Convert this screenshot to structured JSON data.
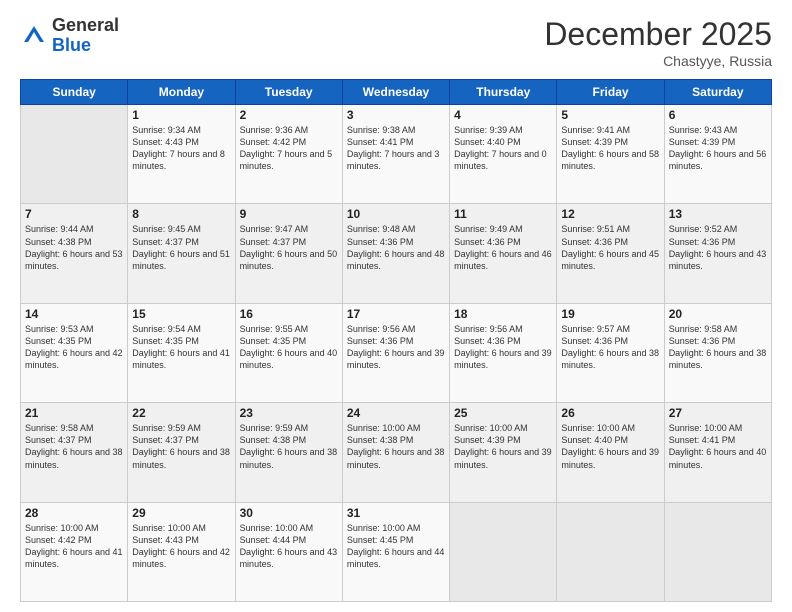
{
  "logo": {
    "general": "General",
    "blue": "Blue"
  },
  "header": {
    "title": "December 2025",
    "location": "Chastyye, Russia"
  },
  "weekdays": [
    "Sunday",
    "Monday",
    "Tuesday",
    "Wednesday",
    "Thursday",
    "Friday",
    "Saturday"
  ],
  "weeks": [
    [
      {
        "day": "",
        "content": ""
      },
      {
        "day": "1",
        "sunrise": "Sunrise: 9:34 AM",
        "sunset": "Sunset: 4:43 PM",
        "daylight": "Daylight: 7 hours and 8 minutes."
      },
      {
        "day": "2",
        "sunrise": "Sunrise: 9:36 AM",
        "sunset": "Sunset: 4:42 PM",
        "daylight": "Daylight: 7 hours and 5 minutes."
      },
      {
        "day": "3",
        "sunrise": "Sunrise: 9:38 AM",
        "sunset": "Sunset: 4:41 PM",
        "daylight": "Daylight: 7 hours and 3 minutes."
      },
      {
        "day": "4",
        "sunrise": "Sunrise: 9:39 AM",
        "sunset": "Sunset: 4:40 PM",
        "daylight": "Daylight: 7 hours and 0 minutes."
      },
      {
        "day": "5",
        "sunrise": "Sunrise: 9:41 AM",
        "sunset": "Sunset: 4:39 PM",
        "daylight": "Daylight: 6 hours and 58 minutes."
      },
      {
        "day": "6",
        "sunrise": "Sunrise: 9:43 AM",
        "sunset": "Sunset: 4:39 PM",
        "daylight": "Daylight: 6 hours and 56 minutes."
      }
    ],
    [
      {
        "day": "7",
        "sunrise": "Sunrise: 9:44 AM",
        "sunset": "Sunset: 4:38 PM",
        "daylight": "Daylight: 6 hours and 53 minutes."
      },
      {
        "day": "8",
        "sunrise": "Sunrise: 9:45 AM",
        "sunset": "Sunset: 4:37 PM",
        "daylight": "Daylight: 6 hours and 51 minutes."
      },
      {
        "day": "9",
        "sunrise": "Sunrise: 9:47 AM",
        "sunset": "Sunset: 4:37 PM",
        "daylight": "Daylight: 6 hours and 50 minutes."
      },
      {
        "day": "10",
        "sunrise": "Sunrise: 9:48 AM",
        "sunset": "Sunset: 4:36 PM",
        "daylight": "Daylight: 6 hours and 48 minutes."
      },
      {
        "day": "11",
        "sunrise": "Sunrise: 9:49 AM",
        "sunset": "Sunset: 4:36 PM",
        "daylight": "Daylight: 6 hours and 46 minutes."
      },
      {
        "day": "12",
        "sunrise": "Sunrise: 9:51 AM",
        "sunset": "Sunset: 4:36 PM",
        "daylight": "Daylight: 6 hours and 45 minutes."
      },
      {
        "day": "13",
        "sunrise": "Sunrise: 9:52 AM",
        "sunset": "Sunset: 4:36 PM",
        "daylight": "Daylight: 6 hours and 43 minutes."
      }
    ],
    [
      {
        "day": "14",
        "sunrise": "Sunrise: 9:53 AM",
        "sunset": "Sunset: 4:35 PM",
        "daylight": "Daylight: 6 hours and 42 minutes."
      },
      {
        "day": "15",
        "sunrise": "Sunrise: 9:54 AM",
        "sunset": "Sunset: 4:35 PM",
        "daylight": "Daylight: 6 hours and 41 minutes."
      },
      {
        "day": "16",
        "sunrise": "Sunrise: 9:55 AM",
        "sunset": "Sunset: 4:35 PM",
        "daylight": "Daylight: 6 hours and 40 minutes."
      },
      {
        "day": "17",
        "sunrise": "Sunrise: 9:56 AM",
        "sunset": "Sunset: 4:36 PM",
        "daylight": "Daylight: 6 hours and 39 minutes."
      },
      {
        "day": "18",
        "sunrise": "Sunrise: 9:56 AM",
        "sunset": "Sunset: 4:36 PM",
        "daylight": "Daylight: 6 hours and 39 minutes."
      },
      {
        "day": "19",
        "sunrise": "Sunrise: 9:57 AM",
        "sunset": "Sunset: 4:36 PM",
        "daylight": "Daylight: 6 hours and 38 minutes."
      },
      {
        "day": "20",
        "sunrise": "Sunrise: 9:58 AM",
        "sunset": "Sunset: 4:36 PM",
        "daylight": "Daylight: 6 hours and 38 minutes."
      }
    ],
    [
      {
        "day": "21",
        "sunrise": "Sunrise: 9:58 AM",
        "sunset": "Sunset: 4:37 PM",
        "daylight": "Daylight: 6 hours and 38 minutes."
      },
      {
        "day": "22",
        "sunrise": "Sunrise: 9:59 AM",
        "sunset": "Sunset: 4:37 PM",
        "daylight": "Daylight: 6 hours and 38 minutes."
      },
      {
        "day": "23",
        "sunrise": "Sunrise: 9:59 AM",
        "sunset": "Sunset: 4:38 PM",
        "daylight": "Daylight: 6 hours and 38 minutes."
      },
      {
        "day": "24",
        "sunrise": "Sunrise: 10:00 AM",
        "sunset": "Sunset: 4:38 PM",
        "daylight": "Daylight: 6 hours and 38 minutes."
      },
      {
        "day": "25",
        "sunrise": "Sunrise: 10:00 AM",
        "sunset": "Sunset: 4:39 PM",
        "daylight": "Daylight: 6 hours and 39 minutes."
      },
      {
        "day": "26",
        "sunrise": "Sunrise: 10:00 AM",
        "sunset": "Sunset: 4:40 PM",
        "daylight": "Daylight: 6 hours and 39 minutes."
      },
      {
        "day": "27",
        "sunrise": "Sunrise: 10:00 AM",
        "sunset": "Sunset: 4:41 PM",
        "daylight": "Daylight: 6 hours and 40 minutes."
      }
    ],
    [
      {
        "day": "28",
        "sunrise": "Sunrise: 10:00 AM",
        "sunset": "Sunset: 4:42 PM",
        "daylight": "Daylight: 6 hours and 41 minutes."
      },
      {
        "day": "29",
        "sunrise": "Sunrise: 10:00 AM",
        "sunset": "Sunset: 4:43 PM",
        "daylight": "Daylight: 6 hours and 42 minutes."
      },
      {
        "day": "30",
        "sunrise": "Sunrise: 10:00 AM",
        "sunset": "Sunset: 4:44 PM",
        "daylight": "Daylight: 6 hours and 43 minutes."
      },
      {
        "day": "31",
        "sunrise": "Sunrise: 10:00 AM",
        "sunset": "Sunset: 4:45 PM",
        "daylight": "Daylight: 6 hours and 44 minutes."
      },
      {
        "day": "",
        "content": ""
      },
      {
        "day": "",
        "content": ""
      },
      {
        "day": "",
        "content": ""
      }
    ]
  ]
}
